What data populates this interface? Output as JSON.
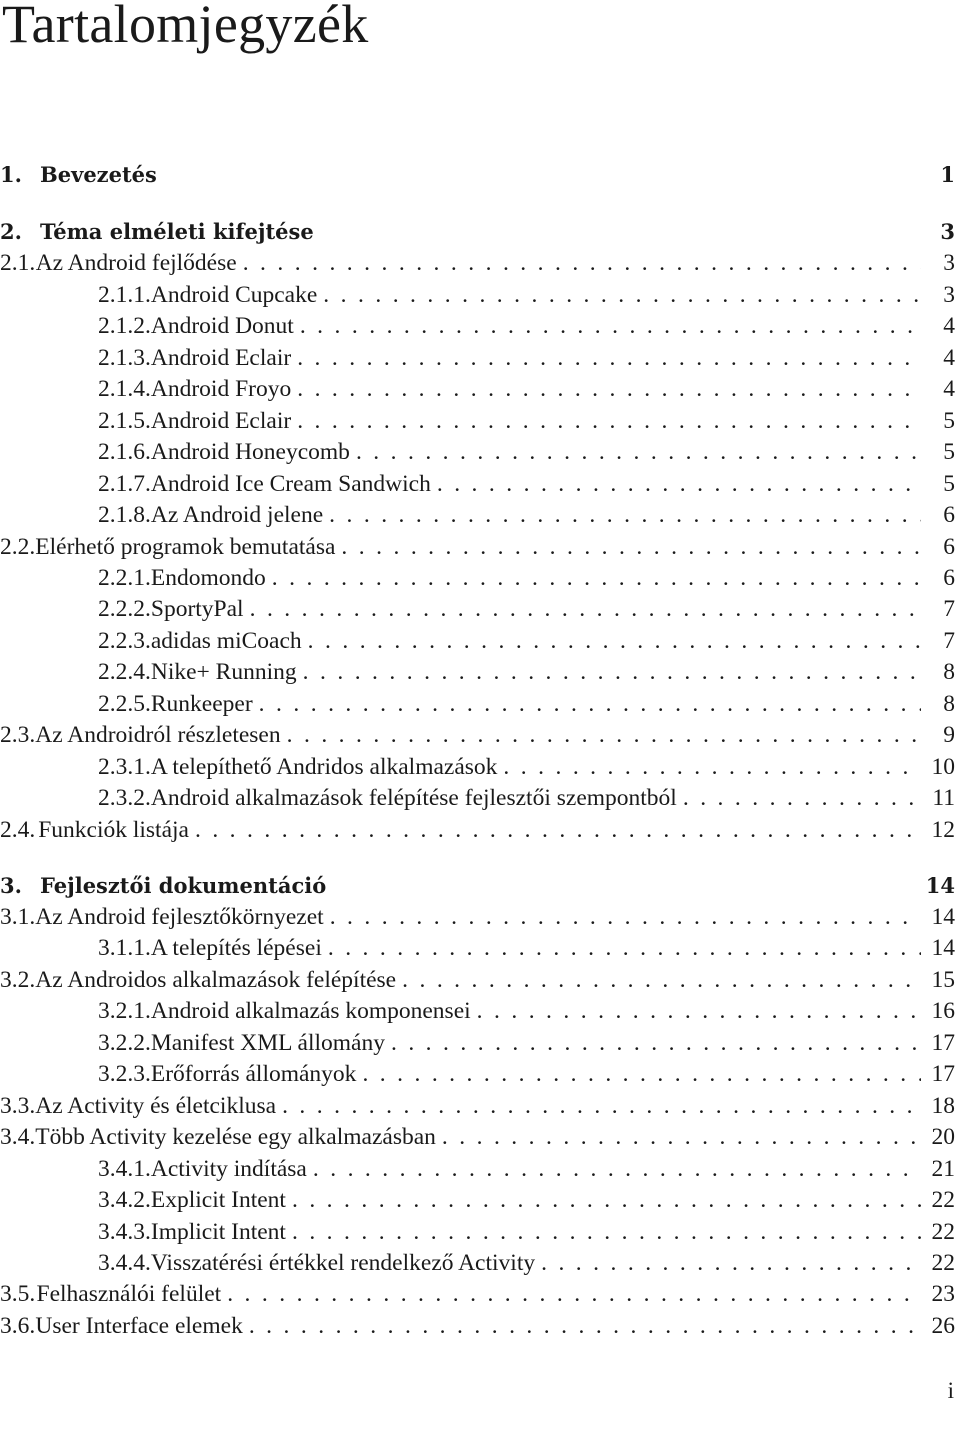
{
  "document": {
    "title": "Tartalomjegyzék",
    "page_number": "i"
  },
  "toc": [
    {
      "level": 0,
      "num": "1.",
      "label": "Bevezetés",
      "page": "1"
    },
    {
      "level": 0,
      "num": "2.",
      "label": "Téma elméleti kifejtése",
      "page": "3"
    },
    {
      "level": 1,
      "num": "2.1.",
      "label": "Az Android fejlődése",
      "page": "3"
    },
    {
      "level": 2,
      "num": "2.1.1.",
      "label": "Android Cupcake",
      "page": "3"
    },
    {
      "level": 2,
      "num": "2.1.2.",
      "label": "Android Donut",
      "page": "4"
    },
    {
      "level": 2,
      "num": "2.1.3.",
      "label": "Android Eclair",
      "page": "4"
    },
    {
      "level": 2,
      "num": "2.1.4.",
      "label": "Android Froyo",
      "page": "4"
    },
    {
      "level": 2,
      "num": "2.1.5.",
      "label": "Android Eclair",
      "page": "5"
    },
    {
      "level": 2,
      "num": "2.1.6.",
      "label": "Android Honeycomb",
      "page": "5"
    },
    {
      "level": 2,
      "num": "2.1.7.",
      "label": "Android Ice Cream Sandwich",
      "page": "5"
    },
    {
      "level": 2,
      "num": "2.1.8.",
      "label": "Az Android jelene",
      "page": "6"
    },
    {
      "level": 1,
      "num": "2.2.",
      "label": "Elérhető programok bemutatása",
      "page": "6"
    },
    {
      "level": 2,
      "num": "2.2.1.",
      "label": "Endomondo",
      "page": "6"
    },
    {
      "level": 2,
      "num": "2.2.2.",
      "label": "SportyPal",
      "page": "7"
    },
    {
      "level": 2,
      "num": "2.2.3.",
      "label": "adidas miCoach",
      "page": "7"
    },
    {
      "level": 2,
      "num": "2.2.4.",
      "label": "Nike+ Running",
      "page": "8"
    },
    {
      "level": 2,
      "num": "2.2.5.",
      "label": "Runkeeper",
      "page": "8"
    },
    {
      "level": 1,
      "num": "2.3.",
      "label": "Az Androidról részletesen",
      "page": "9"
    },
    {
      "level": 2,
      "num": "2.3.1.",
      "label": "A telepíthető Andridos alkalmazások",
      "page": "10"
    },
    {
      "level": 2,
      "num": "2.3.2.",
      "label": "Android alkalmazások felépítése fejlesztői szempontból",
      "page": "11"
    },
    {
      "level": 1,
      "num": "2.4.",
      "label": "Funkciók listája",
      "page": "12"
    },
    {
      "level": 0,
      "num": "3.",
      "label": "Fejlesztői dokumentáció",
      "page": "14"
    },
    {
      "level": 1,
      "num": "3.1.",
      "label": "Az Android fejlesztőkörnyezet",
      "page": "14"
    },
    {
      "level": 2,
      "num": "3.1.1.",
      "label": "A telepítés lépései",
      "page": "14"
    },
    {
      "level": 1,
      "num": "3.2.",
      "label": "Az Androidos alkalmazások felépítése",
      "page": "15"
    },
    {
      "level": 2,
      "num": "3.2.1.",
      "label": "Android alkalmazás komponensei",
      "page": "16"
    },
    {
      "level": 2,
      "num": "3.2.2.",
      "label": "Manifest XML állomány",
      "page": "17"
    },
    {
      "level": 2,
      "num": "3.2.3.",
      "label": "Erőforrás állományok",
      "page": "17"
    },
    {
      "level": 1,
      "num": "3.3.",
      "label": "Az Activity és életciklusa",
      "page": "18"
    },
    {
      "level": 1,
      "num": "3.4.",
      "label": "Több Activity kezelése egy alkalmazásban",
      "page": "20"
    },
    {
      "level": 2,
      "num": "3.4.1.",
      "label": "Activity indítása",
      "page": "21"
    },
    {
      "level": 2,
      "num": "3.4.2.",
      "label": "Explicit Intent",
      "page": "22"
    },
    {
      "level": 2,
      "num": "3.4.3.",
      "label": "Implicit Intent",
      "page": "22"
    },
    {
      "level": 2,
      "num": "3.4.4.",
      "label": "Visszatérési értékkel rendelkező Activity",
      "page": "22"
    },
    {
      "level": 1,
      "num": "3.5.",
      "label": "Felhasználói felület",
      "page": "23"
    },
    {
      "level": 1,
      "num": "3.6.",
      "label": "User Interface elemek",
      "page": "26"
    }
  ]
}
